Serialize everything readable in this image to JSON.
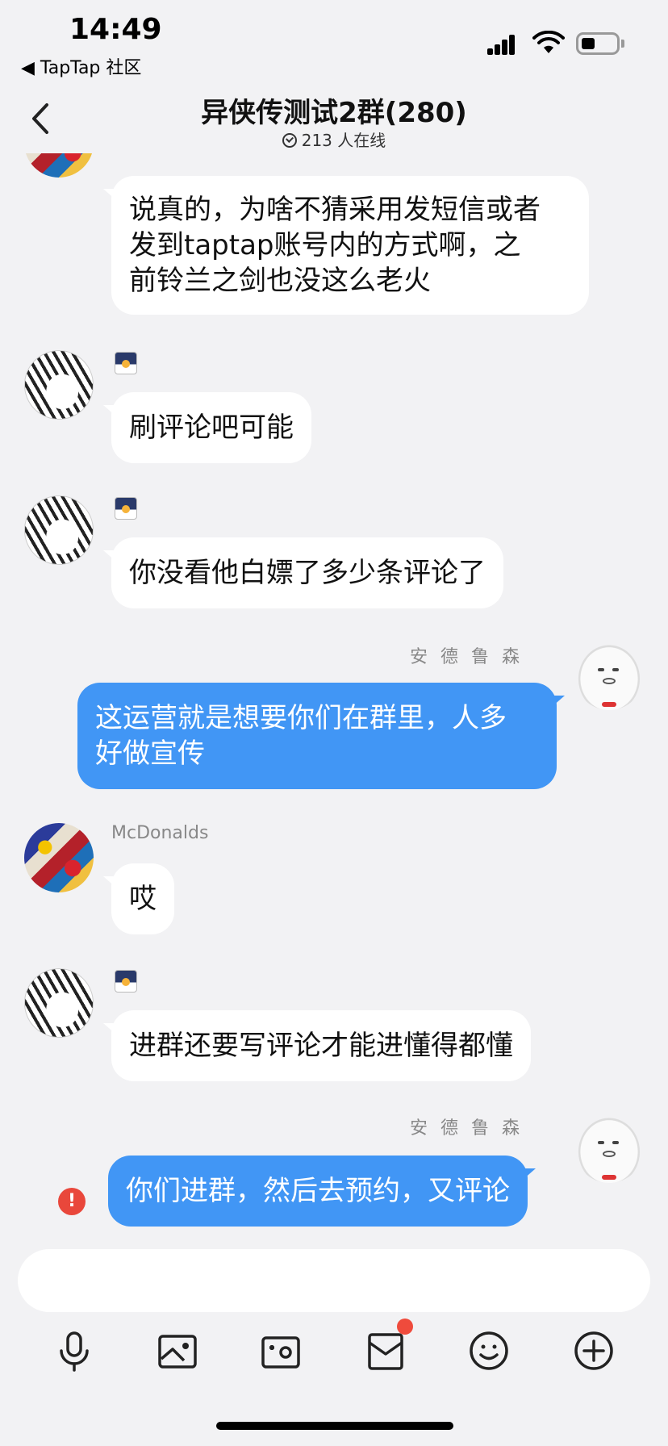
{
  "status_bar": {
    "time": "14:49",
    "back_app": "◀ TapTap 社区",
    "signal_icon": "signal-icon",
    "wifi_icon": "wifi-icon",
    "battery_icon": "battery-icon"
  },
  "header": {
    "title": "异侠传测试2群(280)",
    "online": "213 人在线"
  },
  "messages": [
    {
      "side": "left",
      "avatar": "collage",
      "sender": "",
      "text_lines": [
        "说真的，为啥不猜采用发短信或者",
        "发到taptap账号内的方式啊，之",
        "前铃兰之剑也没这么老火"
      ]
    },
    {
      "side": "left",
      "avatar": "manga",
      "sender": "",
      "text_lines": [
        "刷评论吧可能"
      ]
    },
    {
      "side": "left",
      "avatar": "manga",
      "sender": "",
      "text_lines": [
        "你没看他白嫖了多少条评论了"
      ]
    },
    {
      "side": "right",
      "avatar": "meme",
      "sender": "安德鲁森",
      "text_lines": [
        "这运营就是想要你们在群里，人多",
        "好做宣传"
      ]
    },
    {
      "side": "left",
      "avatar": "collage",
      "sender": "McDonalds",
      "text_lines": [
        "哎"
      ]
    },
    {
      "side": "left",
      "avatar": "manga",
      "sender": "",
      "text_lines": [
        "进群还要写评论才能进懂得都懂"
      ]
    },
    {
      "side": "right",
      "avatar": "meme",
      "sender": "安德鲁森",
      "text_lines": [
        "你们进群，然后去预约，又评论"
      ],
      "failed": true
    }
  ],
  "input": {
    "placeholder": ""
  },
  "toolbar": [
    "microphone-icon",
    "image-icon",
    "camera-icon",
    "envelope-icon",
    "emoji-icon",
    "plus-icon"
  ],
  "colors": {
    "bubble_self": "#4196f5",
    "bubble_other": "#ffffff",
    "background": "#f2f2f4",
    "error": "#e9473b"
  }
}
